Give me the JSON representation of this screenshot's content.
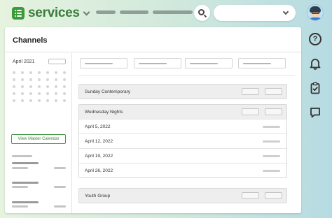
{
  "app": {
    "name": "services",
    "brand_color": "#3d9a3a"
  },
  "topbar": {
    "nav_items": [
      "",
      "",
      ""
    ],
    "search_icon": "search-icon",
    "org_select_value": ""
  },
  "rail": {
    "icons": [
      "help-icon",
      "bell-icon",
      "clipboard-check-icon",
      "chat-icon"
    ],
    "help_glyph": "?"
  },
  "panel": {
    "title": "Channels"
  },
  "sidebar": {
    "month": "April 2021",
    "master_calendar_label": "View Master Calendar"
  },
  "sections": [
    {
      "title": "Sunday Contemporary",
      "rows": []
    },
    {
      "title": "Wednesday Nights",
      "rows": [
        {
          "date": "April 5, 2022"
        },
        {
          "date": "April 12, 2022"
        },
        {
          "date": "April 19, 2022"
        },
        {
          "date": "April 26, 2022"
        }
      ]
    },
    {
      "title": "Youth Group",
      "rows": []
    }
  ]
}
